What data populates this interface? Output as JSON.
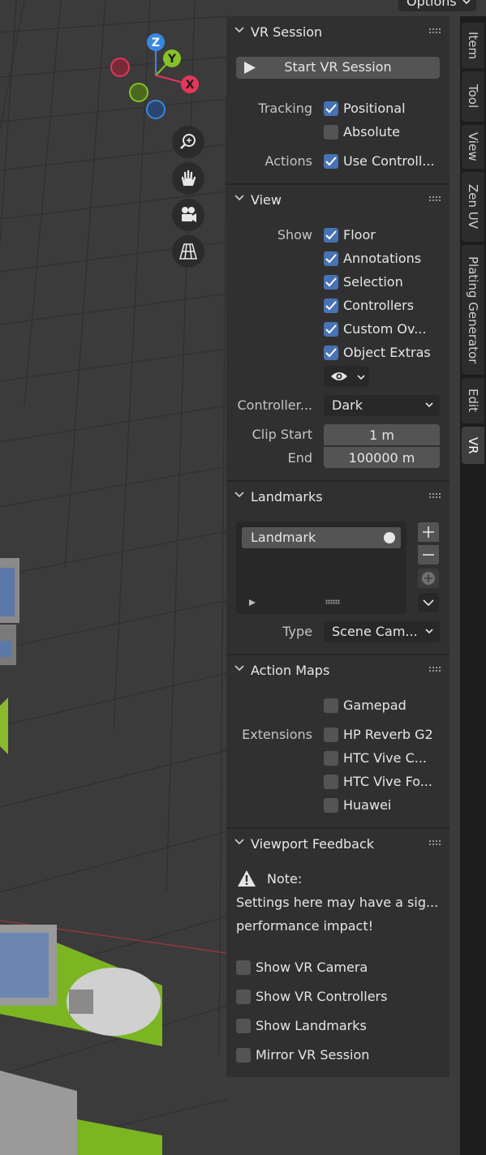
{
  "top_menu": {
    "options_label": "Options"
  },
  "gizmo": {
    "z": "Z",
    "y": "Y",
    "x": "X"
  },
  "tabs": [
    {
      "label": "Item"
    },
    {
      "label": "Tool"
    },
    {
      "label": "View"
    },
    {
      "label": "Zen UV"
    },
    {
      "label": "Plating Generator"
    },
    {
      "label": "Edit"
    },
    {
      "label": "VR"
    }
  ],
  "vr_session": {
    "title": "VR Session",
    "start_button": "Start VR Session",
    "tracking_label": "Tracking",
    "positional": {
      "label": "Positional",
      "checked": true
    },
    "absolute": {
      "label": "Absolute",
      "checked": false
    },
    "actions_label": "Actions",
    "use_controllers": {
      "label": "Use Controll...",
      "checked": true
    }
  },
  "view": {
    "title": "View",
    "show_label": "Show",
    "items": [
      {
        "label": "Floor",
        "checked": true
      },
      {
        "label": "Annotations",
        "checked": true
      },
      {
        "label": "Selection",
        "checked": true
      },
      {
        "label": "Controllers",
        "checked": true
      },
      {
        "label": "Custom Ov...",
        "checked": true
      },
      {
        "label": "Object Extras",
        "checked": true
      }
    ],
    "controller_label": "Controller...",
    "controller_value": "Dark",
    "clip_start_label": "Clip Start",
    "clip_start_value": "1 m",
    "end_label": "End",
    "end_value": "100000 m"
  },
  "landmarks": {
    "title": "Landmarks",
    "list_item": "Landmark",
    "type_label": "Type",
    "type_value": "Scene Cam..."
  },
  "action_maps": {
    "title": "Action Maps",
    "extensions_label": "Extensions",
    "items": [
      {
        "label": "Gamepad",
        "checked": false
      },
      {
        "label": "HP Reverb G2",
        "checked": false
      },
      {
        "label": "HTC Vive C...",
        "checked": false
      },
      {
        "label": "HTC Vive Fo...",
        "checked": false
      },
      {
        "label": "Huawei",
        "checked": false
      }
    ]
  },
  "viewport_feedback": {
    "title": "Viewport Feedback",
    "note_label": "Note:",
    "note_line1": "Settings here may have a sig...",
    "note_line2": "performance impact!",
    "items": [
      {
        "label": "Show VR Camera",
        "checked": false
      },
      {
        "label": "Show VR Controllers",
        "checked": false
      },
      {
        "label": "Show Landmarks",
        "checked": false
      },
      {
        "label": "Mirror VR Session",
        "checked": false
      }
    ]
  },
  "colors": {
    "accent": "#4772b3",
    "panel": "#303030",
    "x_axis": "#e5365a",
    "y_axis": "#86c126",
    "z_axis": "#3a87e3"
  }
}
